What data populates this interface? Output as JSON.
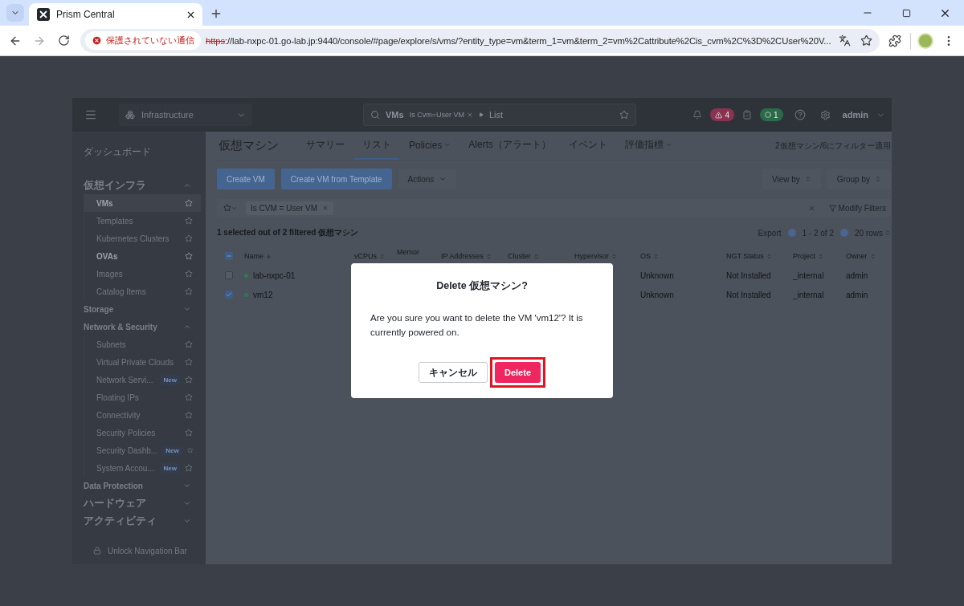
{
  "browser": {
    "tabs": [
      {
        "title": "Prism Central",
        "selected": true
      }
    ],
    "security_label": "保護されていない通信",
    "url_scheme": "https",
    "url_rest": "://lab-nxpc-01.go-lab.jp:9440/console/#page/explore/s/vms/?entity_type=vm&term_1=vm&term_2=vm%2Cattribute%2Cis_cvm%2C%3D%2CUser%20V..."
  },
  "header": {
    "context": "Infrastructure",
    "search": {
      "entity": "VMs",
      "chip": "Is Cvm=User VM",
      "view": "List"
    },
    "alerts_count": "4",
    "tasks_count": "1",
    "user": "admin"
  },
  "sidebar": {
    "top_item": "ダッシュボード",
    "sections": [
      {
        "label": "仮想インフラ",
        "expanded": true,
        "children": [
          {
            "label": "VMs",
            "selected": true,
            "emphasized": true
          },
          {
            "label": "Templates",
            "selected": false,
            "emphasized": false
          },
          {
            "label": "Kubernetes Clusters",
            "selected": false,
            "emphasized": false
          },
          {
            "label": "OVAs",
            "selected": false,
            "emphasized": true
          },
          {
            "label": "Images",
            "selected": false,
            "emphasized": false
          },
          {
            "label": "Catalog Items",
            "selected": false,
            "emphasized": false
          }
        ]
      },
      {
        "label": "Storage",
        "expanded": false
      },
      {
        "label": "Network & Security",
        "expanded": true,
        "children": [
          {
            "label": "Subnets",
            "selected": false,
            "emphasized": false
          },
          {
            "label": "Virtual Private Clouds",
            "selected": false,
            "emphasized": false
          },
          {
            "label": "Network Servi...",
            "badge": "New",
            "selected": false,
            "emphasized": false
          },
          {
            "label": "Floating IPs",
            "selected": false,
            "emphasized": false
          },
          {
            "label": "Connectivity",
            "selected": false,
            "emphasized": false
          },
          {
            "label": "Security Policies",
            "selected": false,
            "emphasized": false
          },
          {
            "label": "Security Dashb...",
            "badge": "New",
            "selected": false,
            "emphasized": false
          },
          {
            "label": "System Accou...",
            "badge": "New",
            "selected": false,
            "emphasized": false
          }
        ]
      },
      {
        "label": "Data Protection",
        "expanded": false
      },
      {
        "label": "ハードウェア",
        "expanded": false
      },
      {
        "label": "アクティビティ",
        "expanded": false
      }
    ],
    "footer": "Unlock Navigation Bar"
  },
  "main": {
    "title": "仮想マシン",
    "tabs": [
      {
        "label": "サマリー",
        "selected": false,
        "has_menu": false
      },
      {
        "label": "リスト",
        "selected": true,
        "has_menu": false
      },
      {
        "label": "Policies",
        "selected": false,
        "has_menu": true
      },
      {
        "label": "Alerts（アラート）",
        "selected": false,
        "has_menu": false
      },
      {
        "label": "イベント",
        "selected": false,
        "has_menu": false
      },
      {
        "label": "評価指標",
        "selected": false,
        "has_menu": true
      }
    ],
    "filter_note": "2仮想マシン/6にフィルター適用",
    "toolbar": [
      {
        "label": "Create VM",
        "kind": "primary"
      },
      {
        "label": "Create VM from Template",
        "kind": "primary"
      },
      {
        "label": "Actions",
        "kind": "menu"
      }
    ],
    "toolbar_right": [
      "View by",
      "Group by"
    ],
    "filter_chip": "Is CVM = User VM",
    "modify_filters": "Modify Filters",
    "selection_summary": "1 selected out of 2 filtered 仮想マシン",
    "export": "Export",
    "pager": "1 - 2 of 2",
    "rows_per_page": "20 rows",
    "table": {
      "select_all": {
        "indeterminate": true
      },
      "columns": [
        "Name",
        "vCPUs",
        "Memor",
        "IP Addresses",
        "Cluster",
        "Hypervisor",
        "OS",
        "NGT Status",
        "Project",
        "Owner"
      ],
      "rows": [
        {
          "checked": false,
          "powered_on": true,
          "name": "lab-nxpc-01",
          "os": "Unknown",
          "ngt_status": "Not Installed",
          "project": "_internal",
          "owner": "admin"
        },
        {
          "checked": true,
          "powered_on": true,
          "name": "vm12",
          "os": "Unknown",
          "ngt_status": "Not Installed",
          "project": "_internal",
          "owner": "admin"
        }
      ]
    }
  },
  "dialog": {
    "title": "Delete 仮想マシン?",
    "message": "Are you sure you want to delete the VM 'vm12'? It is currently powered on.",
    "cancel": "キャンセル",
    "confirm": {
      "label": "Delete",
      "highlighted": true
    }
  }
}
